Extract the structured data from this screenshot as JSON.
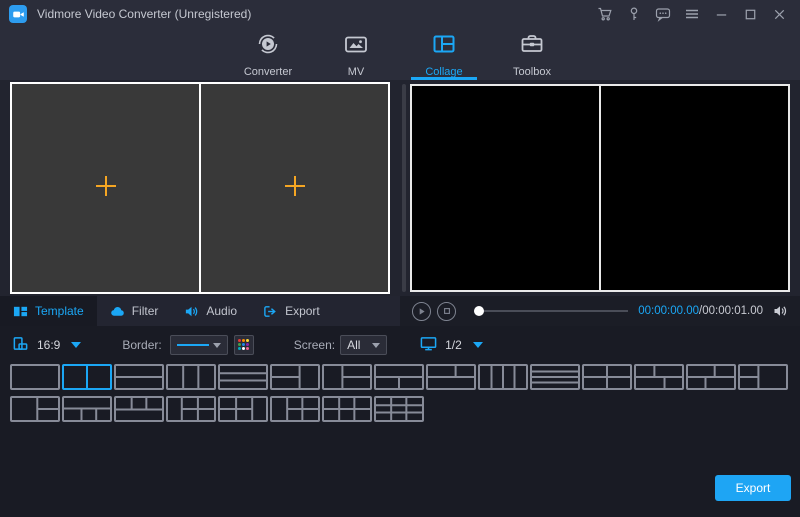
{
  "titlebar": {
    "title": "Vidmore Video Converter (Unregistered)"
  },
  "nav": {
    "tabs": [
      {
        "label": "Converter",
        "active": false
      },
      {
        "label": "MV",
        "active": false
      },
      {
        "label": "Collage",
        "active": true
      },
      {
        "label": "Toolbox",
        "active": false
      }
    ]
  },
  "tool_tabs": [
    {
      "label": "Template",
      "active": true
    },
    {
      "label": "Filter",
      "active": false
    },
    {
      "label": "Audio",
      "active": false
    },
    {
      "label": "Export",
      "active": false
    }
  ],
  "player": {
    "current_time": "00:00:00.00",
    "separator": "/",
    "total_time": "00:00:01.00",
    "progress_percent": 0
  },
  "options": {
    "aspect_ratio": "16:9",
    "border_label": "Border:",
    "screen_label": "Screen:",
    "screen_value": "All",
    "page": "1/2"
  },
  "templates": {
    "selected": {
      "row": 0,
      "index": 1
    },
    "rows": [
      [
        {
          "lines": []
        },
        {
          "lines": [
            [
              50,
              0,
              50,
              100
            ]
          ]
        },
        {
          "lines": [
            [
              0,
              50,
              100,
              50
            ]
          ]
        },
        {
          "lines": [
            [
              33,
              0,
              33,
              100
            ],
            [
              66,
              0,
              66,
              100
            ]
          ]
        },
        {
          "lines": [
            [
              0,
              33,
              100,
              33
            ],
            [
              0,
              66,
              100,
              66
            ]
          ]
        },
        {
          "lines": [
            [
              60,
              0,
              60,
              100
            ],
            [
              0,
              50,
              60,
              50
            ]
          ]
        },
        {
          "lines": [
            [
              40,
              0,
              40,
              100
            ],
            [
              40,
              50,
              100,
              50
            ]
          ]
        },
        {
          "lines": [
            [
              0,
              50,
              100,
              50
            ],
            [
              50,
              50,
              50,
              100
            ]
          ]
        },
        {
          "lines": [
            [
              0,
              50,
              100,
              50
            ],
            [
              60,
              0,
              60,
              50
            ]
          ]
        },
        {
          "lines": [
            [
              25,
              0,
              25,
              100
            ],
            [
              50,
              0,
              50,
              100
            ],
            [
              75,
              0,
              75,
              100
            ]
          ]
        },
        {
          "lines": [
            [
              0,
              25,
              100,
              25
            ],
            [
              0,
              50,
              100,
              50
            ],
            [
              0,
              75,
              100,
              75
            ]
          ]
        },
        {
          "lines": [
            [
              50,
              0,
              50,
              100
            ],
            [
              0,
              50,
              100,
              50
            ]
          ]
        },
        {
          "lines": [
            [
              0,
              50,
              100,
              50
            ],
            [
              40,
              0,
              40,
              50
            ],
            [
              62,
              50,
              62,
              100
            ]
          ]
        },
        {
          "lines": [
            [
              0,
              50,
              100,
              50
            ],
            [
              58,
              0,
              58,
              50
            ],
            [
              38,
              50,
              38,
              100
            ]
          ]
        },
        {
          "lines": [
            [
              40,
              0,
              40,
              100
            ],
            [
              0,
              50,
              40,
              50
            ]
          ]
        }
      ],
      [
        {
          "lines": [
            [
              55,
              0,
              55,
              100
            ],
            [
              55,
              50,
              100,
              50
            ]
          ]
        },
        {
          "lines": [
            [
              0,
              48,
              100,
              48
            ],
            [
              38,
              48,
              38,
              100
            ],
            [
              70,
              48,
              70,
              100
            ]
          ]
        },
        {
          "lines": [
            [
              0,
              52,
              100,
              52
            ],
            [
              34,
              0,
              34,
              52
            ],
            [
              66,
              0,
              66,
              52
            ]
          ]
        },
        {
          "lines": [
            [
              30,
              0,
              30,
              100
            ],
            [
              30,
              50,
              100,
              50
            ],
            [
              65,
              0,
              65,
              100
            ]
          ]
        },
        {
          "lines": [
            [
              35,
              0,
              35,
              100
            ],
            [
              70,
              0,
              70,
              100
            ],
            [
              0,
              50,
              70,
              50
            ]
          ]
        },
        {
          "lines": [
            [
              33,
              0,
              33,
              100
            ],
            [
              66,
              0,
              66,
              100
            ],
            [
              33,
              50,
              100,
              50
            ]
          ]
        },
        {
          "lines": [
            [
              33,
              0,
              33,
              100
            ],
            [
              66,
              0,
              66,
              100
            ],
            [
              0,
              50,
              100,
              50
            ]
          ]
        },
        {
          "lines": [
            [
              33,
              0,
              33,
              100
            ],
            [
              66,
              0,
              66,
              100
            ],
            [
              0,
              33,
              100,
              33
            ],
            [
              0,
              66,
              100,
              66
            ]
          ]
        }
      ]
    ]
  },
  "footer": {
    "export_label": "Export"
  },
  "colors": {
    "accent": "#1BA7F5",
    "plus_icon": "#F5A623",
    "template_border": "#878B98",
    "export_button": "#1EA5F4",
    "picker_dots": [
      "#E53935",
      "#FB8C00",
      "#FDD835",
      "#43A047",
      "#1E88E5",
      "#8E24AA",
      "#00ACC1",
      "#FFFFFF",
      "#F06292"
    ]
  }
}
